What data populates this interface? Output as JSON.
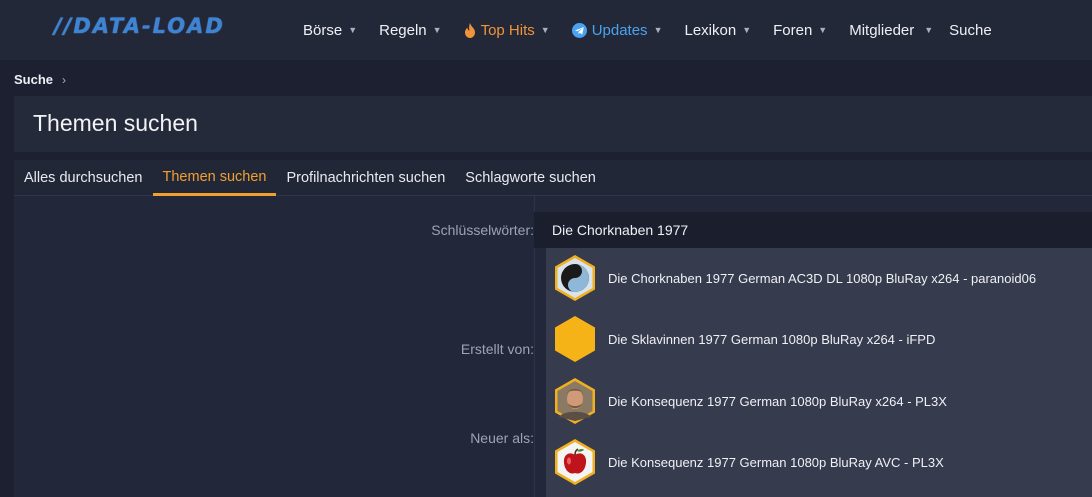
{
  "header": {
    "logo": "//DATA-LOAD",
    "nav": [
      {
        "label": "Börse",
        "has_caret": true
      },
      {
        "label": "Regeln",
        "has_caret": true
      },
      {
        "label": "Top Hits",
        "has_caret": true,
        "icon": "flame-icon",
        "color": "#f0943a"
      },
      {
        "label": "Updates",
        "has_caret": true,
        "icon": "telegram-icon",
        "color": "#4aa3ee"
      },
      {
        "label": "Lexikon",
        "has_caret": true
      },
      {
        "label": "Foren",
        "has_caret": true
      },
      {
        "label": "Mitglieder",
        "has_caret": true
      },
      {
        "label": "Suche",
        "has_caret": false
      }
    ]
  },
  "breadcrumb": {
    "item": "Suche"
  },
  "page": {
    "title": "Themen suchen"
  },
  "tabs": [
    {
      "label": "Alles durchsuchen",
      "active": false
    },
    {
      "label": "Themen suchen",
      "active": true
    },
    {
      "label": "Profilnachrichten suchen",
      "active": false
    },
    {
      "label": "Schlagworte suchen",
      "active": false
    }
  ],
  "form": {
    "keywords_label": "Schlüsselwörter:",
    "keywords_value": "Die Chorknaben 1977",
    "created_by_label": "Erstellt von:",
    "newer_than_label": "Neuer als:"
  },
  "suggestions": [
    {
      "text": "Die Chorknaben 1977 German AC3D DL 1080p BluRay x264 - paranoid06",
      "avatar": "yin-yang-avatar"
    },
    {
      "text": "Die Sklavinnen 1977 German 1080p BluRay x264 - iFPD",
      "avatar": "default-avatar"
    },
    {
      "text": "Die Konsequenz 1977 German 1080p BluRay x264 - PL3X",
      "avatar": "portrait-avatar"
    },
    {
      "text": "Die Konsequenz 1977 German 1080p BluRay AVC - PL3X",
      "avatar": "apple-avatar"
    }
  ],
  "colors": {
    "accent": "#f0a030",
    "brand": "#3d84d6",
    "hot": "#f0943a",
    "updates": "#4aa3ee"
  }
}
